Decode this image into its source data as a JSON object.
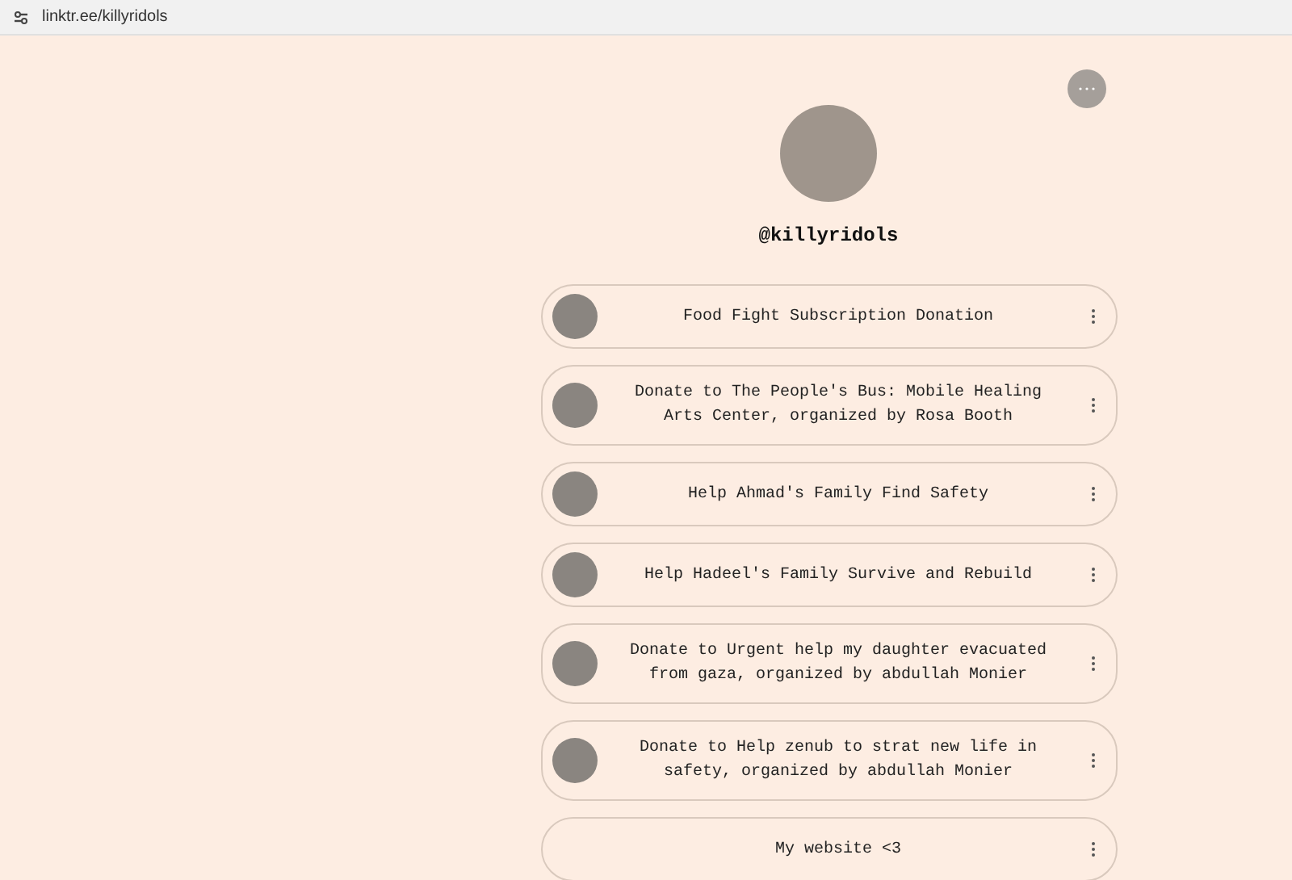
{
  "address_bar": {
    "url": "linktr.ee/killyridols"
  },
  "profile": {
    "username": "@killyridols"
  },
  "links": [
    {
      "title": "Food Fight Subscription Donation",
      "thumbnail": true
    },
    {
      "title": "Donate to The People's Bus: Mobile Healing Arts Center, organized by Rosa Booth",
      "thumbnail": true
    },
    {
      "title": "Help Ahmad's Family Find Safety",
      "thumbnail": true
    },
    {
      "title": "Help Hadeel's Family Survive and Rebuild",
      "thumbnail": true
    },
    {
      "title": "Donate to Urgent help my daughter evacuated from gaza, organized by abdullah Monier",
      "thumbnail": true
    },
    {
      "title": "Donate to Help zenub to strat new life in safety, organized by abdullah Monier",
      "thumbnail": true
    },
    {
      "title": "My website <3",
      "thumbnail": false
    }
  ]
}
